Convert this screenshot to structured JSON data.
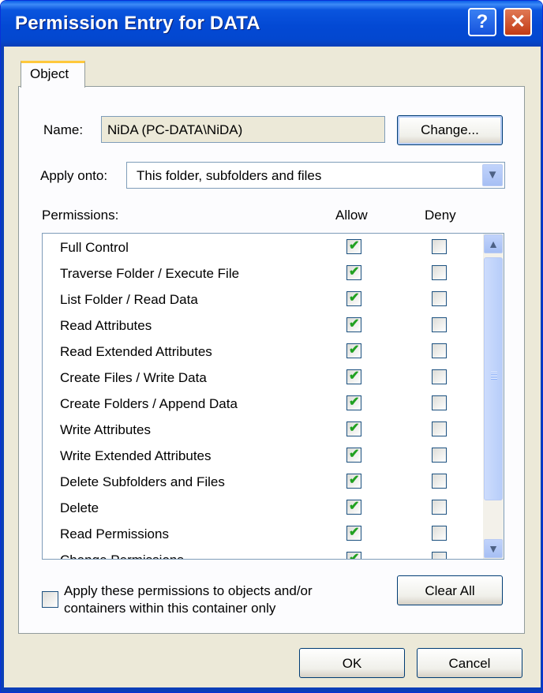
{
  "window": {
    "title": "Permission Entry for DATA",
    "help_glyph": "?",
    "close_glyph": "✕"
  },
  "tabs": [
    {
      "label": "Object",
      "active": true
    }
  ],
  "name_field": {
    "label": "Name:",
    "value": "NiDA (PC-DATA\\NiDA)",
    "change_button": "Change..."
  },
  "apply_onto": {
    "label": "Apply onto:",
    "selected": "This folder, subfolders and files"
  },
  "permissions": {
    "label": "Permissions:",
    "allow_header": "Allow",
    "deny_header": "Deny",
    "rows": [
      {
        "name": "Full Control",
        "allow": true,
        "deny": false
      },
      {
        "name": "Traverse Folder / Execute File",
        "allow": true,
        "deny": false
      },
      {
        "name": "List Folder / Read Data",
        "allow": true,
        "deny": false
      },
      {
        "name": "Read Attributes",
        "allow": true,
        "deny": false
      },
      {
        "name": "Read Extended Attributes",
        "allow": true,
        "deny": false
      },
      {
        "name": "Create Files / Write Data",
        "allow": true,
        "deny": false
      },
      {
        "name": "Create Folders / Append Data",
        "allow": true,
        "deny": false
      },
      {
        "name": "Write Attributes",
        "allow": true,
        "deny": false
      },
      {
        "name": "Write Extended Attributes",
        "allow": true,
        "deny": false
      },
      {
        "name": "Delete Subfolders and Files",
        "allow": true,
        "deny": false
      },
      {
        "name": "Delete",
        "allow": true,
        "deny": false
      },
      {
        "name": "Read Permissions",
        "allow": true,
        "deny": false
      },
      {
        "name": "Change Permissions",
        "allow": true,
        "deny": false
      }
    ]
  },
  "apply_only": {
    "label_line1": "Apply these permissions to objects and/or",
    "label_line2": "containers within this container only",
    "checked": false
  },
  "clear_all_button": "Clear All",
  "ok_button": "OK",
  "cancel_button": "Cancel",
  "colors": {
    "titlebar": "#0349d4",
    "dialog": "#ece9d8",
    "check": "#21a121",
    "tab_accent": "#ffc83c"
  }
}
